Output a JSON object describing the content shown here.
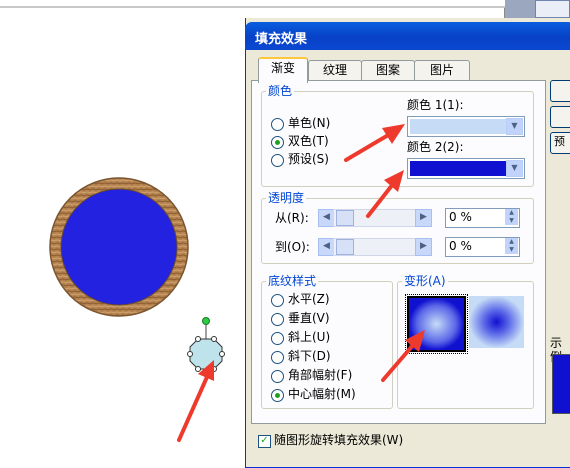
{
  "dialog": {
    "title": "填充效果",
    "tabs": [
      "渐变",
      "纹理",
      "图案",
      "图片"
    ],
    "active_tab": "渐变"
  },
  "colors_group": {
    "label": "颜色",
    "options": [
      "单色(N)",
      "双色(T)",
      "预设(S)"
    ],
    "selected": "双色(T)",
    "color1_label": "颜色 1(1):",
    "color1_value": "#c6dcf6",
    "color2_label": "颜色 2(2):",
    "color2_value": "#1010d0"
  },
  "transparency_group": {
    "label": "透明度",
    "from_label": "从(R):",
    "from_value": "0 %",
    "to_label": "到(O):",
    "to_value": "0 %"
  },
  "shading_group": {
    "label": "底纹样式",
    "options": [
      "水平(Z)",
      "垂直(V)",
      "斜上(U)",
      "斜下(D)",
      "角部幅射(F)",
      "中心幅射(M)"
    ],
    "selected": "中心幅射(M)"
  },
  "variants_group": {
    "label": "变形(A)"
  },
  "rotate_checkbox": {
    "label": "随图形旋转填充效果(W)",
    "checked": true
  },
  "side": {
    "button3_label": "预",
    "sample_label": "示例"
  },
  "colors": {
    "accent": "#0a5ddf",
    "circle_fill": "#2222e0",
    "ring": "#b07a4a",
    "annotation_arrow": "#ee3a2c"
  },
  "icons": [
    "title-app-icon",
    "dropdown-arrow-icon",
    "scroll-arrow-icon",
    "annotation-arrow"
  ]
}
